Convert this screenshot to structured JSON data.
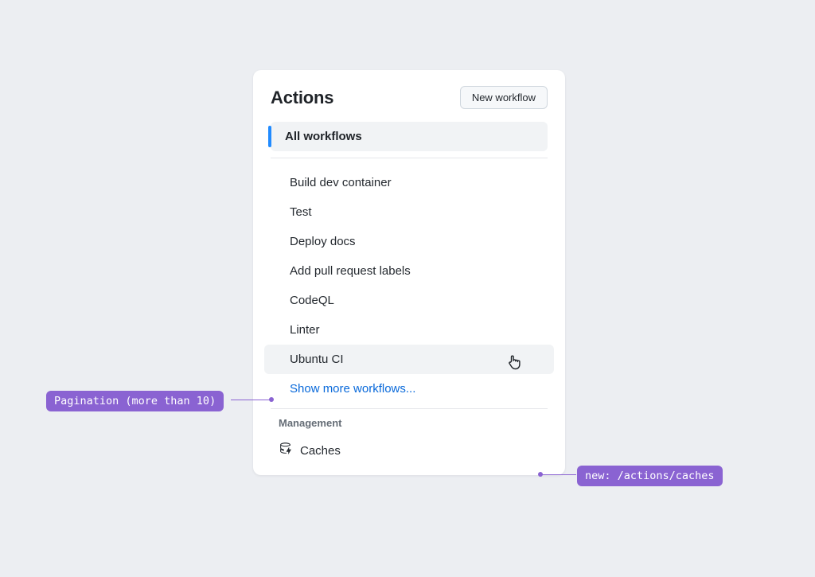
{
  "panel": {
    "title": "Actions",
    "new_workflow_label": "New workflow",
    "all_workflows_label": "All workflows",
    "workflows": [
      "Build dev container",
      "Test",
      "Deploy docs",
      "Add pull request labels",
      "CodeQL",
      "Linter",
      "Ubuntu CI"
    ],
    "show_more_label": "Show more workflows...",
    "management_heading": "Management",
    "caches_label": "Caches"
  },
  "annotations": {
    "left": "Pagination (more than 10)",
    "right": "new: /actions/caches"
  },
  "colors": {
    "accent_blue": "#218bff",
    "link_blue": "#0969da",
    "annotation_purple": "#8a63d2",
    "panel_bg": "#ffffff",
    "page_bg": "#eceef2"
  }
}
